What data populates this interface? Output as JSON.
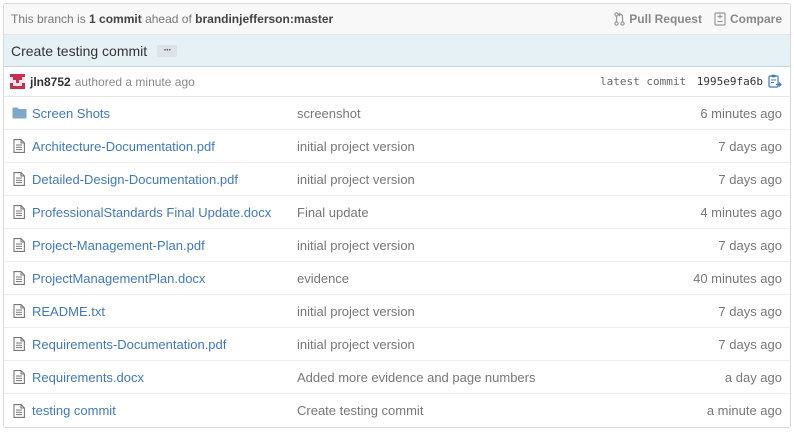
{
  "branch_bar": {
    "prefix": "This branch is",
    "count": "1 commit",
    "middle": "ahead of",
    "target": "brandinjefferson:master",
    "pull_request_label": "Pull Request",
    "compare_label": "Compare"
  },
  "commit": {
    "title": "Create testing commit",
    "ellipsis": "···",
    "author": "jln8752",
    "authored_text": "authored a minute ago",
    "latest_label": "latest commit",
    "sha": "1995e9fa6b"
  },
  "files": [
    {
      "icon": "folder-icon",
      "name": "Screen Shots",
      "message": "screenshot",
      "age": "6 minutes ago"
    },
    {
      "icon": "file-icon",
      "name": "Architecture-Documentation.pdf",
      "message": "initial project version",
      "age": "7 days ago"
    },
    {
      "icon": "file-icon",
      "name": "Detailed-Design-Documentation.pdf",
      "message": "initial project version",
      "age": "7 days ago"
    },
    {
      "icon": "file-icon",
      "name": "ProfessionalStandards Final Update.docx",
      "message": "Final update",
      "age": "4 minutes ago"
    },
    {
      "icon": "file-icon",
      "name": "Project-Management-Plan.pdf",
      "message": "initial project version",
      "age": "7 days ago"
    },
    {
      "icon": "file-icon",
      "name": "ProjectManagementPlan.docx",
      "message": "evidence",
      "age": "40 minutes ago"
    },
    {
      "icon": "file-icon",
      "name": "README.txt",
      "message": "initial project version",
      "age": "7 days ago"
    },
    {
      "icon": "file-icon",
      "name": "Requirements-Documentation.pdf",
      "message": "initial project version",
      "age": "7 days ago"
    },
    {
      "icon": "file-icon",
      "name": "Requirements.docx",
      "message": "Added more evidence and page numbers",
      "age": "a day ago"
    },
    {
      "icon": "file-icon",
      "name": "testing commit",
      "message": "Create testing commit",
      "age": "a minute ago"
    }
  ],
  "colors": {
    "link": "#4078c0",
    "commit_bar_bg": "#e6f1f6",
    "avatar": "#c9304f",
    "folder": "#80a6cd"
  }
}
